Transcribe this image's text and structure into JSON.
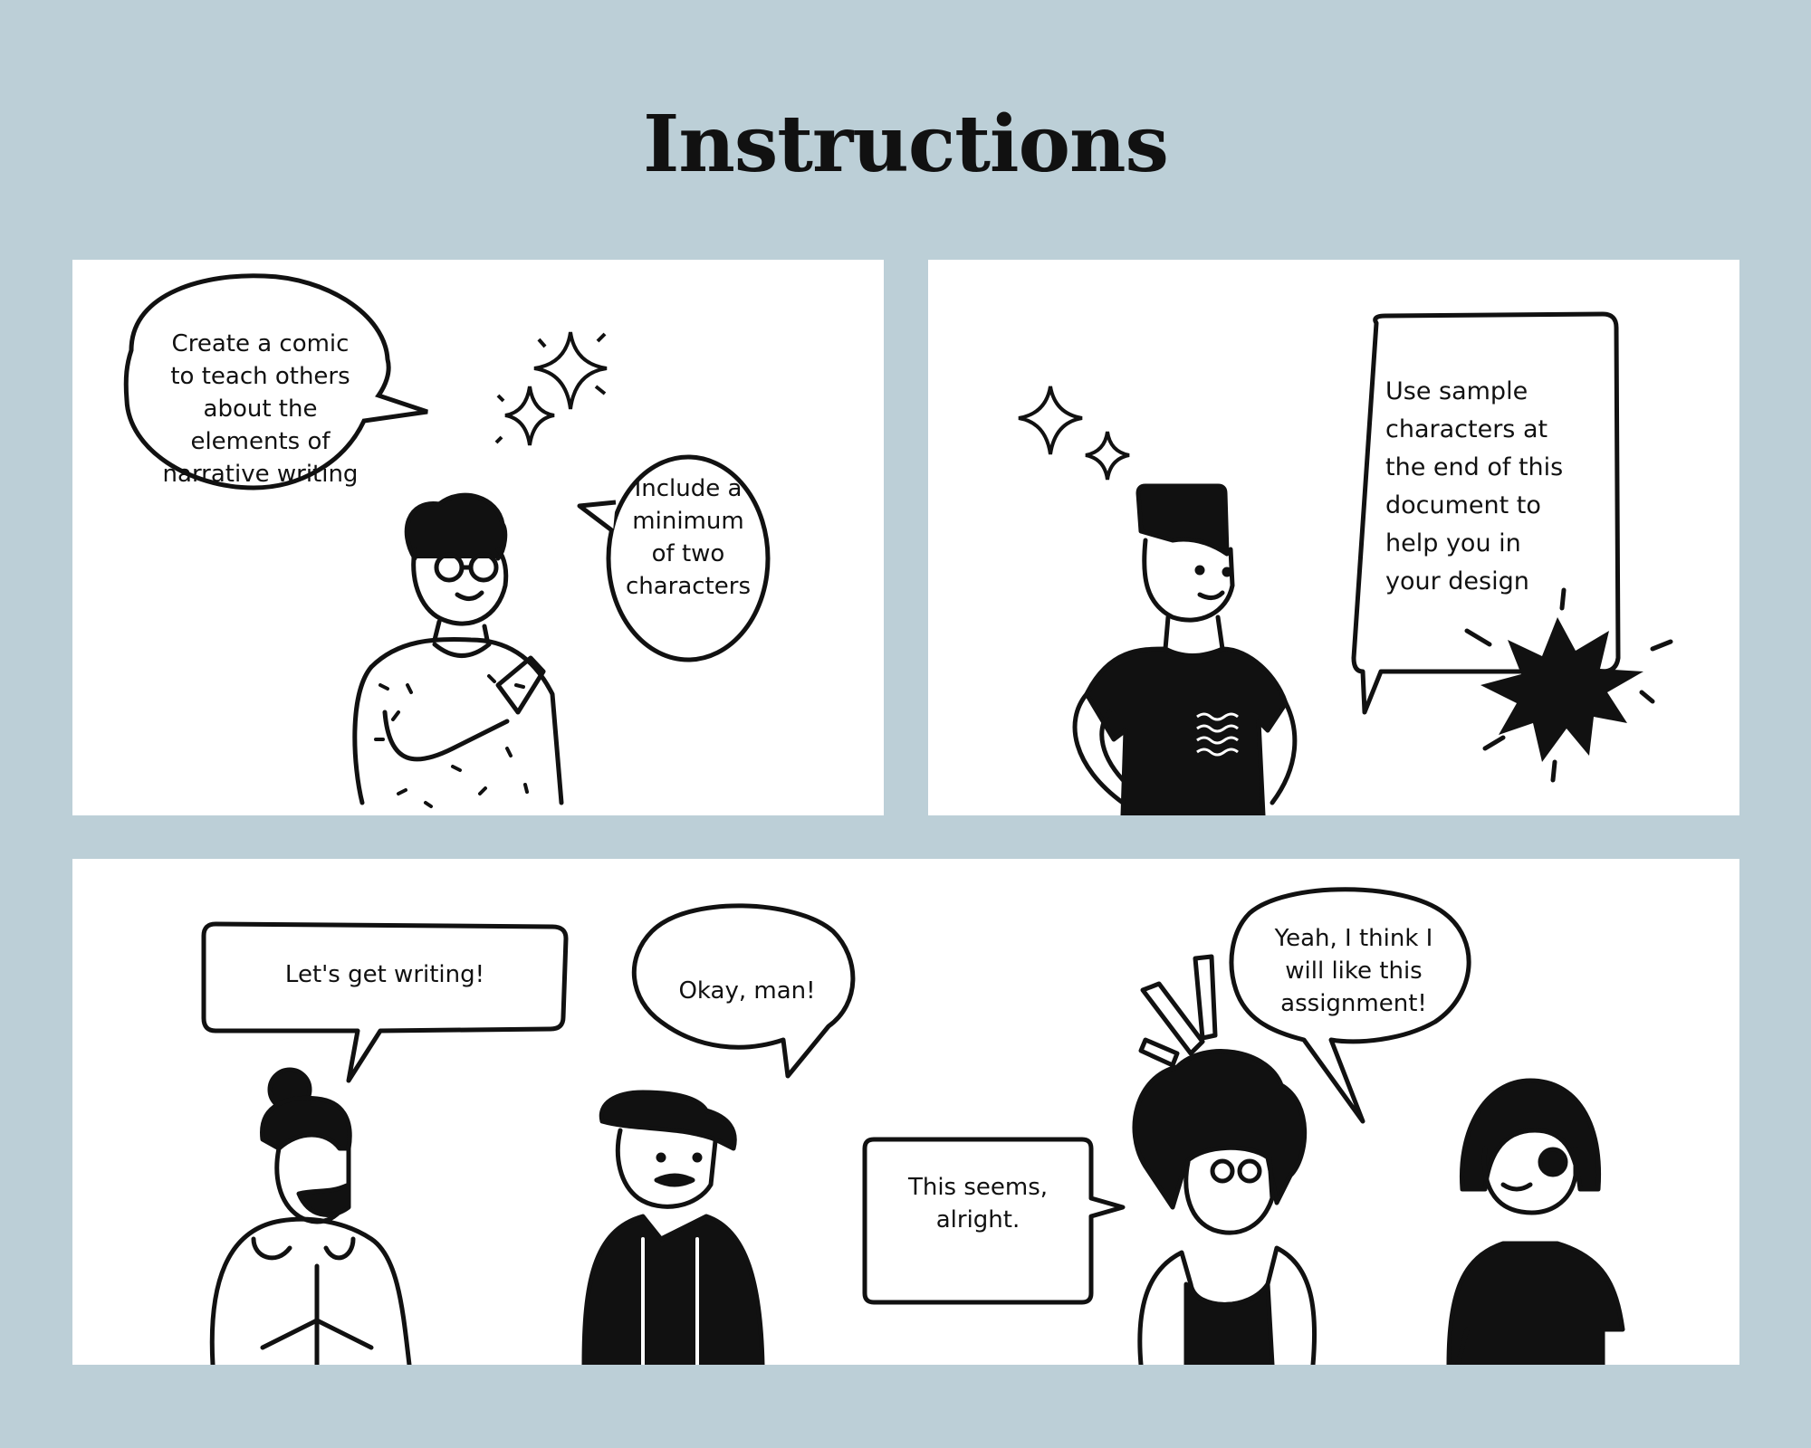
{
  "page": {
    "title": "Instructions"
  },
  "panels": [
    {
      "bubbles": [
        "Create a comic\nto teach others\nabout the\nelements of\nnarrative writing",
        "Include a\nminimum\nof two\ncharacters"
      ]
    },
    {
      "bubbles": [
        "Use sample\ncharacters at\nthe end of this\ndocument to\nhelp you in\nyour design"
      ]
    },
    {
      "bubbles": [
        "Let's get writing!",
        "Okay, man!",
        "This seems,\nalright.",
        "Yeah, I think I\nwill like this\nassignment!"
      ]
    }
  ],
  "colors": {
    "background": "#bccfd7",
    "panel": "#ffffff",
    "ink": "#111111"
  }
}
